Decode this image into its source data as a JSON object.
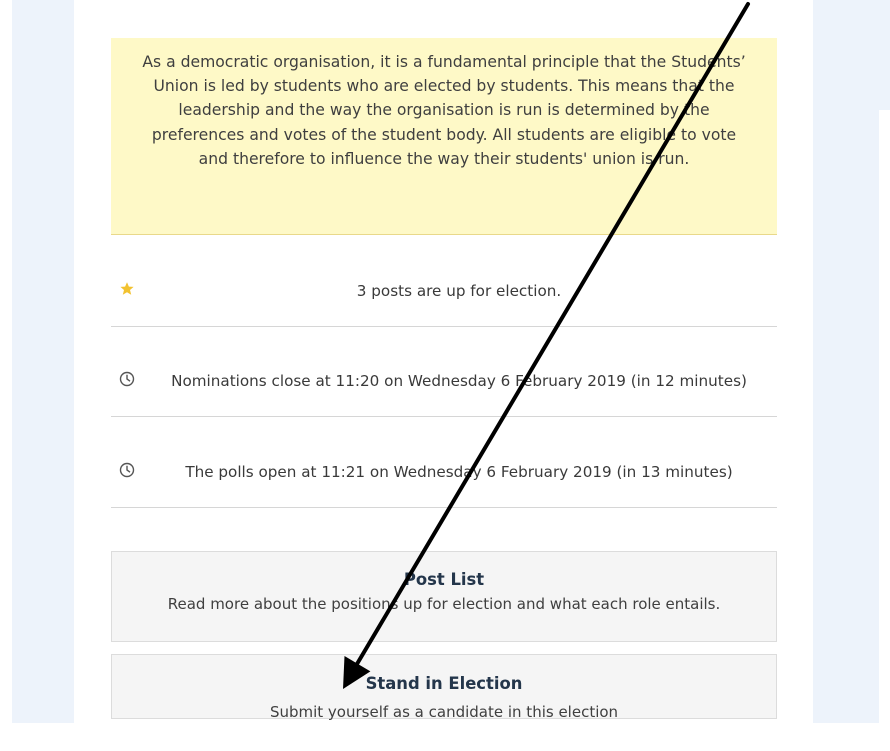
{
  "intro": {
    "text": "As a democratic organisation, it is a fundamental principle that the Students’ Union is led by students who are elected by students. This means that the leadership and the way the organisation is run is determined by the preferences and votes of the student body. All students are eligible to vote and therefore to influence the way their students' union is run."
  },
  "info": {
    "posts": "3 posts are up for election.",
    "nominations": "Nominations close at 11:20 on Wednesday 6 February 2019 (in 12 minutes)",
    "polls": "The polls open at 11:21 on Wednesday 6 February 2019 (in 13 minutes)"
  },
  "cards": {
    "post_list": {
      "title": "Post List",
      "description": "Read more about the positions up for election and what each role entails."
    },
    "stand": {
      "title": "Stand in Election",
      "description": "Submit yourself as a candidate in this election"
    }
  },
  "icons": {
    "posts": "star-icon",
    "nominations": "clock-icon",
    "polls": "clock-icon"
  },
  "colors": {
    "intro_background": "#fef9c7",
    "star": "#f2c230",
    "card_title": "#24364b",
    "side_panel": "#edf3fb"
  }
}
